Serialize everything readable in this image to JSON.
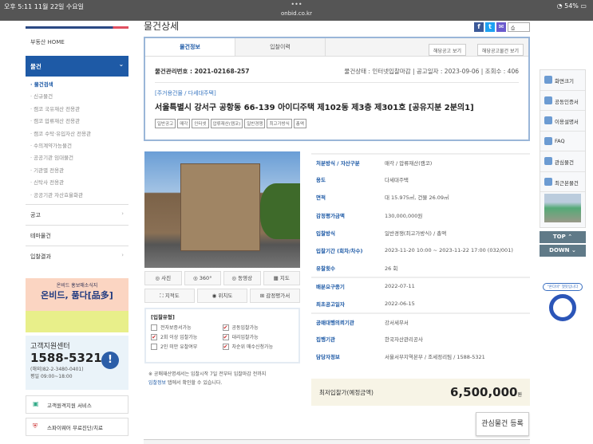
{
  "status": {
    "time": "오후 5:11  11월 22일 수요일",
    "url": "onbid.co.kr",
    "battery": "54%",
    "dots": "•••"
  },
  "sidebar": {
    "home": "부동산 HOME",
    "active": "물건",
    "chevron": "⌄",
    "sub": [
      "물건검색",
      "신규물건",
      "캠코 국유재산 전용관",
      "캠코 압류재산 전용관",
      "캠코 수탁·유입자산 전용관",
      "수의계약가능물건",
      "공공기관 임대물건",
      "기관별 전용관",
      "신탁사 전용관",
      "공공기관 자산효율화관"
    ],
    "items": [
      {
        "label": "공고",
        "chev": "›"
      },
      {
        "label": "테마물건",
        "chev": ""
      },
      {
        "label": "입찰결과",
        "chev": "›"
      }
    ]
  },
  "banner": {
    "line1": "온비드 홍보매소식지",
    "line2": "온비드, 품다[品多]"
  },
  "support": {
    "title": "고객지원센터",
    "phone": "1588-5321",
    "overseas": "(해외)82-2-3480-0401)",
    "hours": "평일 09:00~18:00",
    "remote": "고객원격지원 서비스",
    "spyware": "스파이웨어 무료진단/치료"
  },
  "main": {
    "title": "물건상세",
    "print": "인쇄",
    "tabs": [
      "물건정보",
      "입찰이력"
    ],
    "buttons": [
      "해당공고 보기",
      "해당공고물건 보기"
    ],
    "item_no": "물건관리번호 : 2021-02168-257",
    "meta": "물건상태 : 인터넷입찰마감  |  공고일자 : 2023-09-06  |  조회수 : 406",
    "category": "[주거용건물 / 다세대주택]",
    "address": "서울특별시 강서구 공항동 66-139 아이디주택 제102동 제3층 제301호 [공유지분 2분의1]",
    "tags": [
      "일반공고",
      "매각",
      "인터넷",
      "압류재산(캠코)",
      "일반경쟁",
      "최고가방식",
      "총액"
    ]
  },
  "photo_buttons": [
    "사진",
    "360°",
    "동영상",
    "지도",
    "지적도",
    "위치도",
    "감정평가서"
  ],
  "bid_type": {
    "title": "[입찰유형]",
    "options": [
      {
        "label": "전자보증서가능",
        "checked": false
      },
      {
        "label": "공동입찰가능",
        "checked": true
      },
      {
        "label": "2회 이상 입찰가능",
        "checked": true
      },
      {
        "label": "대리입찰가능",
        "checked": true
      },
      {
        "label": "2인 미만 유찰여부",
        "checked": false
      },
      {
        "label": "차순위 매수신청가능",
        "checked": true
      }
    ]
  },
  "note": {
    "text1": "※ 공매재산명세서는 입찰시작 7일 전부터 입찰마감 전까지",
    "link": "입찰정보",
    "text2": " 탭에서 확인할 수 있습니다."
  },
  "details": [
    {
      "k": "처분방식 / 자산구분",
      "v": "매각 / 압류재산(캠코)"
    },
    {
      "k": "용도",
      "v": "다세대주택"
    },
    {
      "k": "면적",
      "v": "대 15.975㎡, 건물 26.09㎡"
    },
    {
      "k": "감정평가금액",
      "v": "130,000,000원"
    },
    {
      "k": "입찰방식",
      "v": "일반경쟁(최고가방식) / 총액"
    },
    {
      "k": "입찰기간 (회차/차수)",
      "v": "2023-11-20 10:00 ~ 2023-11-22 17:00 (032/001)"
    },
    {
      "k": "유찰횟수",
      "v": "26 회"
    },
    {
      "k": "배분요구종기",
      "v": "2022-07-11"
    },
    {
      "k": "최초공고일자",
      "v": "2022-06-15"
    },
    {
      "k": "공매대행의뢰기관",
      "v": "강서세무서"
    },
    {
      "k": "집행기관",
      "v": "한국자산관리공사"
    },
    {
      "k": "담당자정보",
      "v": "서울서부지역본부 / 조세정리팀 / 1588-5321"
    }
  ],
  "price": {
    "label": "최저입찰가(예정금액)",
    "value": "6,500,000",
    "unit": "원"
  },
  "fav_button": "관심물건 등록",
  "quick": [
    "화면크기",
    "공동인증서",
    "이용설명서",
    "FAQ",
    "관심물건",
    "최근본물건"
  ],
  "top": "TOP ⌃",
  "down": "DOWN ⌄",
  "mascot": "\"온다비\" 챗봇입니다"
}
